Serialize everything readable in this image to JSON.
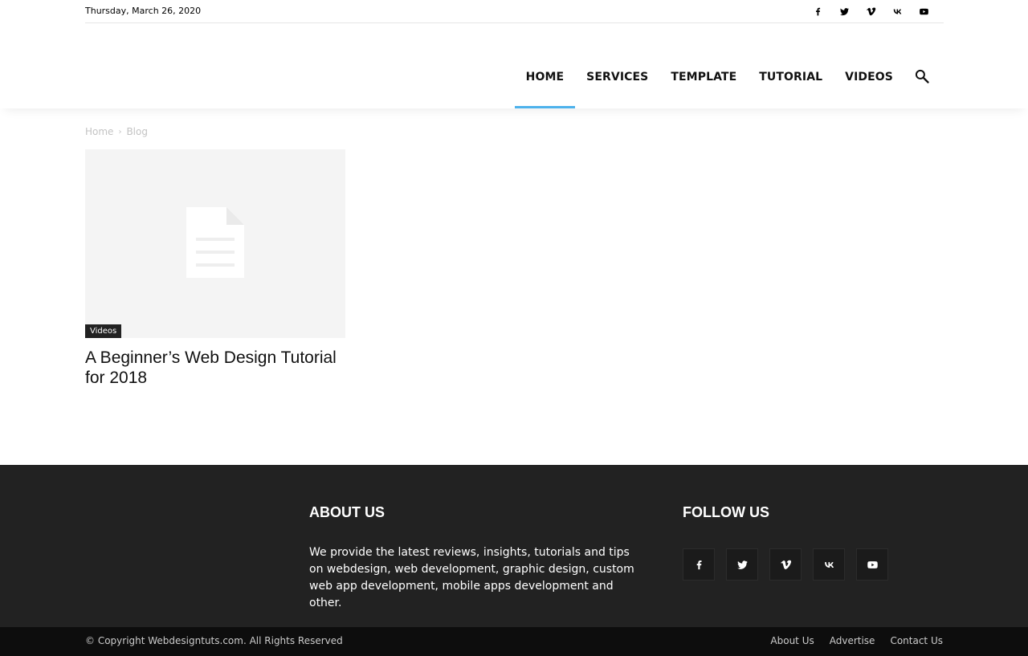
{
  "topbar": {
    "date": "Thursday, March 26, 2020"
  },
  "icons": {
    "facebook": "facebook-icon",
    "twitter": "twitter-icon",
    "vimeo": "vimeo-icon",
    "vk": "vk-icon",
    "youtube": "youtube-icon",
    "search": "search-icon"
  },
  "nav": {
    "items": [
      {
        "label": "HOME",
        "active": true
      },
      {
        "label": "SERVICES",
        "active": false
      },
      {
        "label": "TEMPLATE",
        "active": false
      },
      {
        "label": "TUTORIAL",
        "active": false
      },
      {
        "label": "VIDEOS",
        "active": false
      }
    ],
    "accent": "#4db2ec"
  },
  "breadcrumb": {
    "home": "Home",
    "current": "Blog"
  },
  "post": {
    "category": "Videos",
    "title": "A Beginner’s Web Design Tutorial for 2018"
  },
  "footer": {
    "about_heading": "ABOUT US",
    "about_text": "We provide the latest reviews, insights, tutorials and tips on webdesign, web development, graphic design, custom web app development, mobile apps development and other.",
    "follow_heading": "FOLLOW US",
    "copyright": "© Copyright Webdesigntuts.com. All Rights Reserved",
    "links": [
      "About Us",
      "Advertise",
      "Contact Us"
    ]
  }
}
